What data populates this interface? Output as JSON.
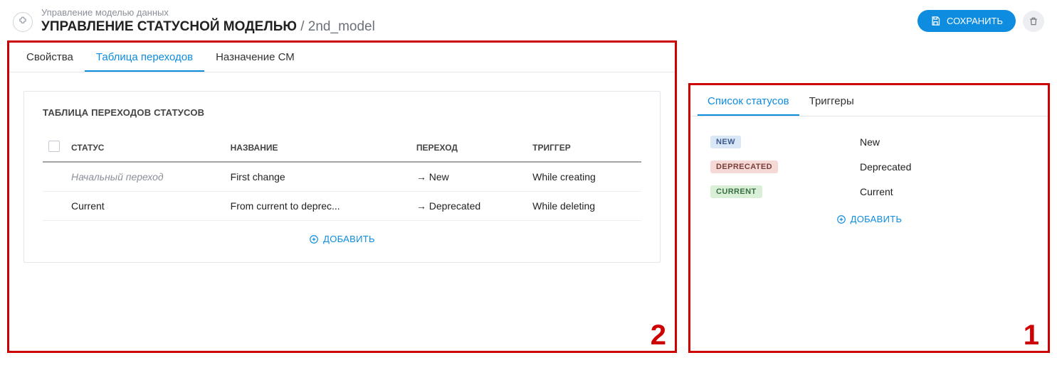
{
  "header": {
    "breadcrumb": "Управление моделью данных",
    "title_main": "УПРАВЛЕНИЕ СТАТУСНОЙ МОДЕЛЬЮ",
    "title_sep": " / ",
    "title_sub": "2nd_model",
    "save_label": "СОХРАНИТЬ"
  },
  "main_tabs": [
    "Свойства",
    "Таблица переходов",
    "Назначение СМ"
  ],
  "main_tabs_active": 1,
  "panel": {
    "title": "ТАБЛИЦА ПЕРЕХОДОВ СТАТУСОВ",
    "columns": {
      "status": "СТАТУС",
      "name": "НАЗВАНИЕ",
      "transition": "ПЕРЕХОД",
      "trigger": "ТРИГГЕР"
    },
    "rows": [
      {
        "status": "Начальный переход",
        "initial": true,
        "name": "First change",
        "transition": "→ New",
        "trigger": "While creating"
      },
      {
        "status": "Current",
        "initial": false,
        "name": "From current to deprec...",
        "transition": "→ Deprecated",
        "trigger": "While deleting"
      }
    ],
    "add_label": "ДОБАВИТЬ"
  },
  "side_tabs": [
    "Список статусов",
    "Триггеры"
  ],
  "side_tabs_active": 0,
  "statuses": [
    {
      "code": "NEW",
      "label": "New",
      "badge_class": "badge-new"
    },
    {
      "code": "DEPRECATED",
      "label": "Deprecated",
      "badge_class": "badge-deprecated"
    },
    {
      "code": "CURRENT",
      "label": "Current",
      "badge_class": "badge-current"
    }
  ],
  "side_add_label": "ДОБАВИТЬ",
  "annotations": {
    "left": "2",
    "right": "1"
  }
}
